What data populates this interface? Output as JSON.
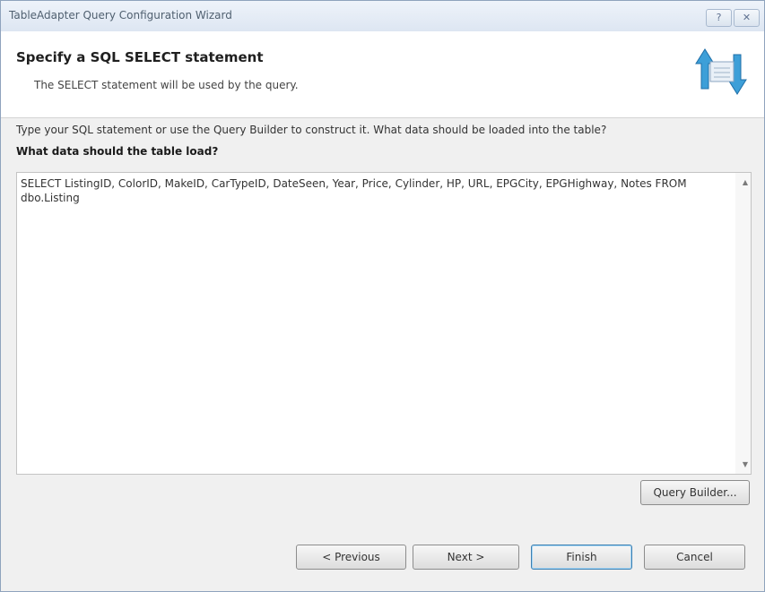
{
  "window": {
    "title": "TableAdapter Query Configuration Wizard",
    "help_glyph": "?",
    "close_glyph": "✕"
  },
  "header": {
    "title": "Specify a SQL SELECT statement",
    "subtitle": "The SELECT statement will be used by the query."
  },
  "body": {
    "instructions": "Type your SQL statement or use the Query Builder to construct it. What data should be loaded into the table?",
    "query_label": "What data should the table load?",
    "sql_text": "SELECT ListingID, ColorID, MakeID, CarTypeID, DateSeen, Year, Price, Cylinder, HP, URL, EPGCity, EPGHighway, Notes FROM dbo.Listing",
    "scroll_up_glyph": "▲",
    "scroll_down_glyph": "▼",
    "query_builder_label": "Query Builder..."
  },
  "footer": {
    "previous_label": "< Previous",
    "next_label": "Next >",
    "finish_label": "Finish",
    "cancel_label": "Cancel"
  }
}
